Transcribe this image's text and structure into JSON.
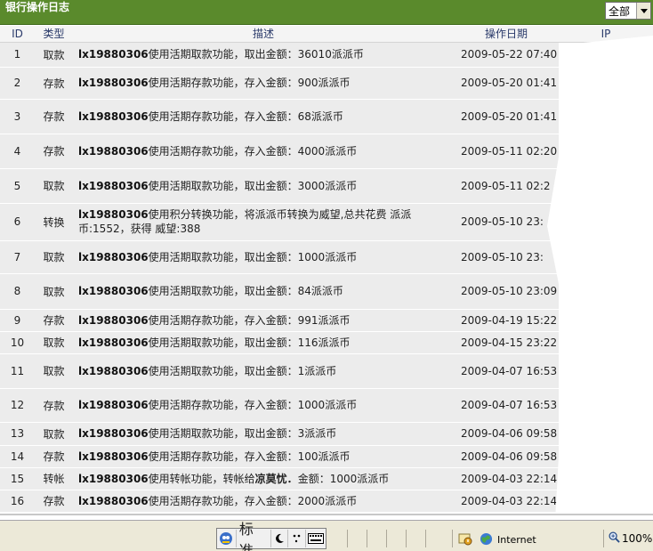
{
  "header": {
    "title": "银行操作日志",
    "filter_value": "全部"
  },
  "table": {
    "columns": {
      "id": "ID",
      "type": "类型",
      "desc": "描述",
      "date": "操作日期",
      "ip": "IP"
    },
    "rows": [
      {
        "id": "1",
        "type": "取款",
        "user": "lx19880306",
        "action": "使用活期取款功能，取出金额：36010派派币",
        "date": "2009-05-22 07:40"
      },
      {
        "id": "2",
        "type": "存款",
        "user": "lx19880306",
        "action": "使用活期存款功能，存入金额：900派派币",
        "date": "2009-05-20 01:41"
      },
      {
        "id": "3",
        "type": "存款",
        "user": "lx19880306",
        "action": "使用活期存款功能，存入金额：68派派币",
        "date": "2009-05-20 01:41"
      },
      {
        "id": "4",
        "type": "存款",
        "user": "lx19880306",
        "action": "使用活期存款功能，存入金额：4000派派币",
        "date": "2009-05-11 02:20"
      },
      {
        "id": "5",
        "type": "取款",
        "user": "lx19880306",
        "action": "使用活期取款功能，取出金额：3000派派币",
        "date": "2009-05-11 02:2"
      },
      {
        "id": "6",
        "type": "转换",
        "user": "lx19880306",
        "action": "使用积分转换功能，将派派币转换为威望,总共花费 派派币:1552，获得 威望:388",
        "date": "2009-05-10 23:"
      },
      {
        "id": "7",
        "type": "取款",
        "user": "lx19880306",
        "action": "使用活期取款功能，取出金额：1000派派币",
        "date": "2009-05-10 23:"
      },
      {
        "id": "8",
        "type": "取款",
        "user": "lx19880306",
        "action": "使用活期取款功能，取出金额：84派派币",
        "date": "2009-05-10 23:09"
      },
      {
        "id": "9",
        "type": "存款",
        "user": "lx19880306",
        "action": "使用活期存款功能，存入金额：991派派币",
        "date": "2009-04-19 15:22"
      },
      {
        "id": "10",
        "type": "取款",
        "user": "lx19880306",
        "action": "使用活期取款功能，取出金额：116派派币",
        "date": "2009-04-15 23:22"
      },
      {
        "id": "11",
        "type": "取款",
        "user": "lx19880306",
        "action": "使用活期取款功能，取出金额：1派派币",
        "date": "2009-04-07 16:53"
      },
      {
        "id": "12",
        "type": "存款",
        "user": "lx19880306",
        "action": "使用活期存款功能，存入金额：1000派派币",
        "date": "2009-04-07 16:53"
      },
      {
        "id": "13",
        "type": "取款",
        "user": "lx19880306",
        "action": "使用活期取款功能，取出金额：3派派币",
        "date": "2009-04-06 09:58"
      },
      {
        "id": "14",
        "type": "存款",
        "user": "lx19880306",
        "action": "使用活期存款功能，存入金额：100派派币",
        "date": "2009-04-06 09:58"
      },
      {
        "id": "15",
        "type": "转帐",
        "user": "lx19880306",
        "action_pre": "使用转帐功能，转帐给",
        "recipient": "凉莫忧．",
        "action_post": "金额：1000派派币",
        "date": "2009-04-03 22:14"
      },
      {
        "id": "16",
        "type": "存款",
        "user": "lx19880306",
        "action": "使用活期存款功能，存入金额：2000派派币",
        "date": "2009-04-03 22:14"
      }
    ]
  },
  "statusbar": {
    "ime_label": "标准",
    "zone_label": "Internet",
    "zoom_label": "100%"
  },
  "colors": {
    "title_bg": "#5a8a2c",
    "row_bg": "#ececec"
  },
  "icons": [
    "chevron-down-icon",
    "ime-logo-icon",
    "moon-icon",
    "punctuation-icon",
    "keyboard-icon",
    "security-zone-icon",
    "globe-icon",
    "zoom-icon"
  ]
}
